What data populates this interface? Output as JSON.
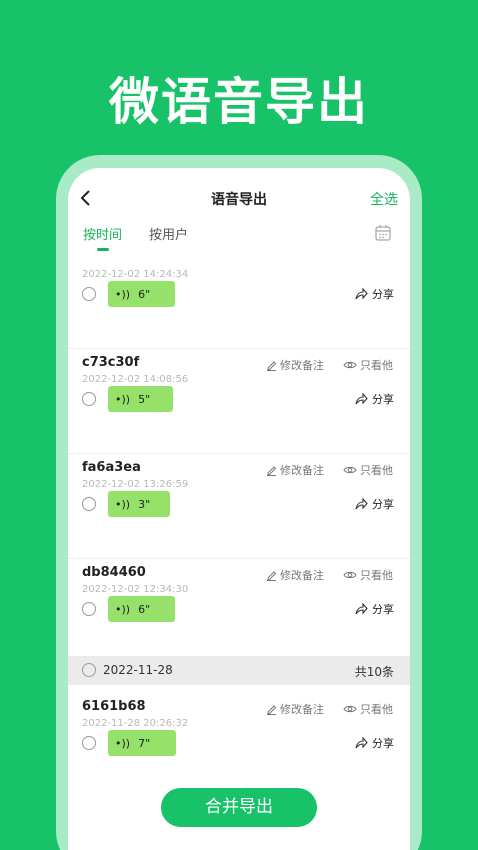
{
  "banner": {
    "title": "微语音导出"
  },
  "nav": {
    "title": "语音导出",
    "select_all": "全选"
  },
  "tabs": [
    {
      "label": "按时间",
      "active": true
    },
    {
      "label": "按用户",
      "active": false
    }
  ],
  "actions": {
    "edit_note": "修改备注",
    "only_view": "只看他",
    "share": "分享"
  },
  "records": [
    {
      "name": "",
      "time": "2022-12-02 14:24:34",
      "duration": "6\"",
      "selected": false
    },
    {
      "name": "c73c30f",
      "time": "2022-12-02 14:08:56",
      "duration": "5\"",
      "selected": false
    },
    {
      "name": "fa6a3ea",
      "time": "2022-12-02 13:26:59",
      "duration": "3\"",
      "selected": false
    },
    {
      "name": "db84460",
      "time": "2022-12-02 12:34:30",
      "duration": "6\"",
      "selected": false
    }
  ],
  "date_group": {
    "date": "2022-11-28",
    "count": "共10条"
  },
  "records_after": [
    {
      "name": "6161b68",
      "time": "2022-11-28 20:26:32",
      "duration": "7\"",
      "selected": false
    }
  ],
  "merge_button": "合并导出",
  "colors": {
    "brand": "#18c268",
    "accent_text": "#17b35c",
    "bubble": "#95e16a"
  }
}
